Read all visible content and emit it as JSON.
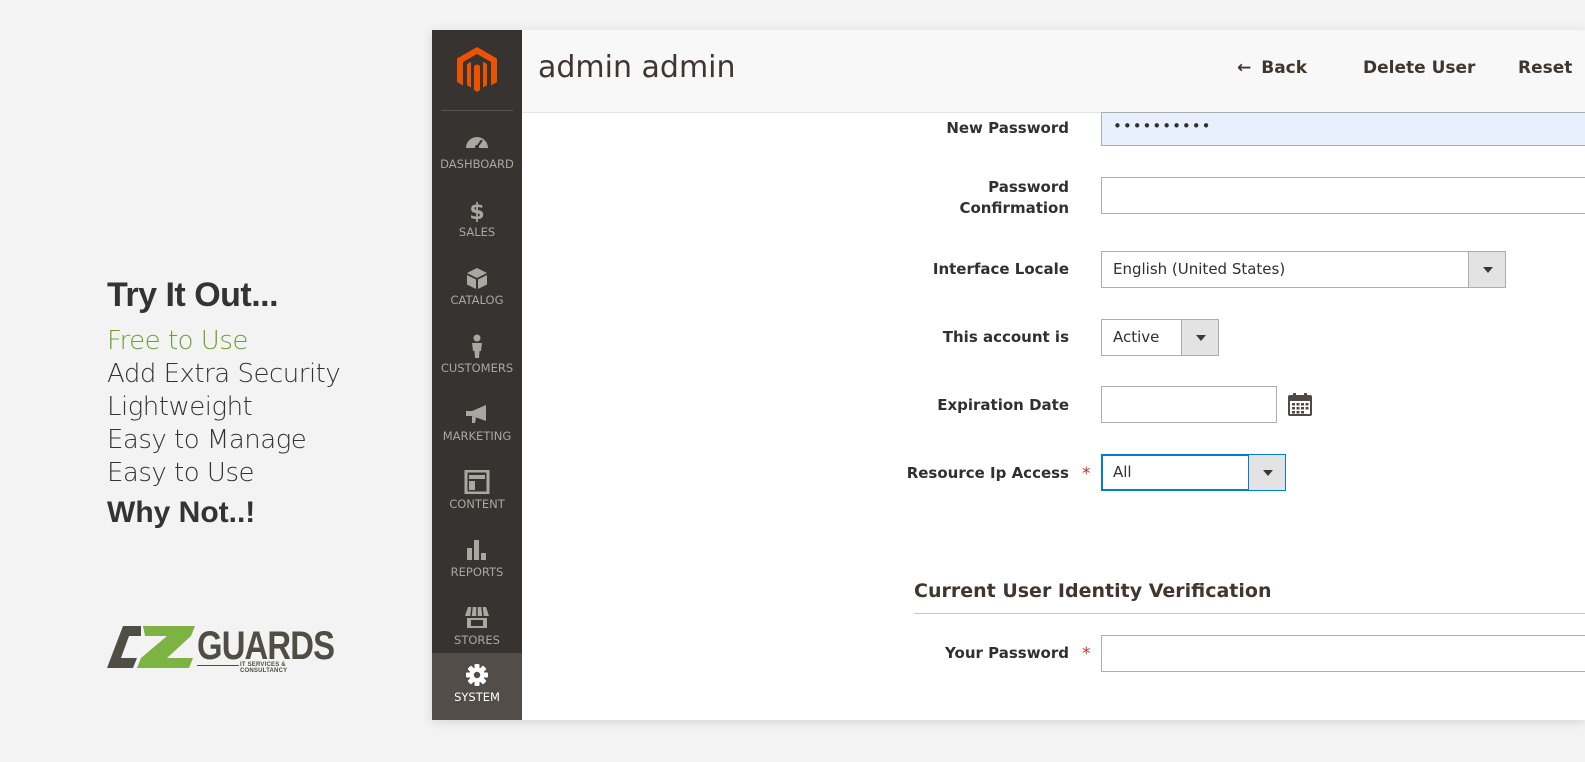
{
  "promo": {
    "title": "Try It Out...",
    "features": [
      "Free to Use",
      "Add Extra Security",
      "Lightweight",
      "Easy to Manage",
      "Easy to Use"
    ],
    "why": "Why Not..!",
    "accent_color": "#6da034"
  },
  "logo": {
    "brand_text": "GUARDS",
    "tagline": "IT SERVICES & CONSULTANCY"
  },
  "sidebar": {
    "items": [
      {
        "label": "DASHBOARD",
        "icon": "dashboard-gauge-icon"
      },
      {
        "label": "SALES",
        "icon": "dollar-icon"
      },
      {
        "label": "CATALOG",
        "icon": "box-icon"
      },
      {
        "label": "CUSTOMERS",
        "icon": "person-icon"
      },
      {
        "label": "MARKETING",
        "icon": "megaphone-icon"
      },
      {
        "label": "CONTENT",
        "icon": "layout-icon"
      },
      {
        "label": "REPORTS",
        "icon": "bar-chart-icon"
      },
      {
        "label": "STORES",
        "icon": "storefront-icon"
      },
      {
        "label": "SYSTEM",
        "icon": "gear-icon"
      }
    ],
    "active": "SYSTEM"
  },
  "header": {
    "title": "admin admin",
    "back_label": "Back",
    "delete_label": "Delete User",
    "reset_label": "Reset"
  },
  "form": {
    "new_password": {
      "label": "New Password",
      "value": "••••••••••"
    },
    "password_confirmation": {
      "label_line1": "Password",
      "label_line2": "Confirmation",
      "value": ""
    },
    "interface_locale": {
      "label": "Interface Locale",
      "value": "English (United States)"
    },
    "account_status": {
      "label": "This account is",
      "value": "Active"
    },
    "expiration_date": {
      "label": "Expiration Date",
      "value": ""
    },
    "resource_ip_access": {
      "label": "Resource Ip Access",
      "value": "All",
      "required": "*"
    }
  },
  "verification": {
    "title": "Current User Identity Verification",
    "your_password": {
      "label": "Your Password",
      "value": "",
      "required": "*"
    }
  },
  "colors": {
    "sidebar_bg": "#373330",
    "sidebar_active": "#524d49",
    "brand_orange": "#eb5202",
    "focus_blue": "#007bdb",
    "required_red": "#e22626"
  }
}
